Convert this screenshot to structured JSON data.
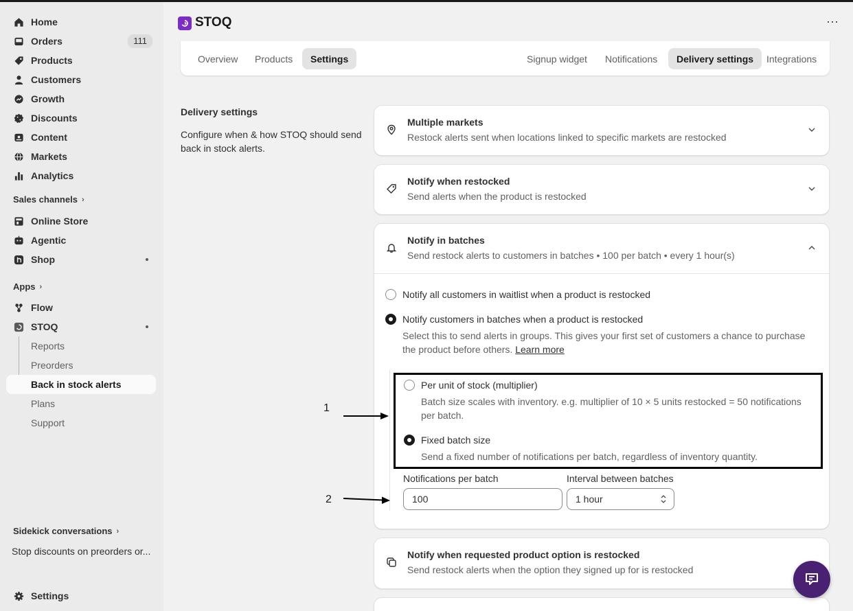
{
  "sidebar": {
    "items": [
      {
        "label": "Home",
        "icon": "home-icon"
      },
      {
        "label": "Orders",
        "icon": "inbox-icon",
        "badge": "111"
      },
      {
        "label": "Products",
        "icon": "tag-icon"
      },
      {
        "label": "Customers",
        "icon": "person-icon"
      },
      {
        "label": "Growth",
        "icon": "growth-icon"
      },
      {
        "label": "Discounts",
        "icon": "discount-icon"
      },
      {
        "label": "Content",
        "icon": "image-icon"
      },
      {
        "label": "Markets",
        "icon": "globe-icon"
      },
      {
        "label": "Analytics",
        "icon": "bar-chart-icon"
      }
    ],
    "sales_channels": {
      "heading": "Sales channels",
      "items": [
        {
          "label": "Online Store",
          "icon": "store-icon"
        },
        {
          "label": "Agentic",
          "icon": "agent-icon"
        },
        {
          "label": "Shop",
          "icon": "shop-icon"
        }
      ]
    },
    "apps": {
      "heading": "Apps",
      "items": [
        {
          "label": "Flow",
          "icon": "flow-icon"
        },
        {
          "label": "STOQ",
          "icon": "stoq-icon"
        }
      ],
      "sub_items": [
        "Reports",
        "Preorders",
        "Back in stock alerts",
        "Plans",
        "Support"
      ]
    },
    "sidekick": {
      "heading": "Sidekick conversations",
      "conversation": "Stop discounts on preorders or..."
    },
    "settings_label": "Settings"
  },
  "header": {
    "app_name": "STOQ",
    "more": "⋯"
  },
  "tabs_left": [
    "Overview",
    "Products",
    "Settings"
  ],
  "tabs_right": [
    "Signup widget",
    "Notifications",
    "Delivery settings",
    "Integrations"
  ],
  "section": {
    "title": "Delivery settings",
    "description": "Configure when & how STOQ should send back in stock alerts."
  },
  "cards": {
    "markets": {
      "title": "Multiple markets",
      "subtitle": "Restock alerts sent when locations linked to specific markets are restocked"
    },
    "restocked": {
      "title": "Notify when restocked",
      "subtitle": "Send alerts when the product is restocked"
    },
    "batches": {
      "title": "Notify in batches",
      "subtitle": "Send restock alerts to customers in batches • 100 per batch • every 1 hour(s)",
      "option_all": "Notify all customers in waitlist when a product is restocked",
      "option_batches": "Notify customers in batches when a product is restocked",
      "batches_help": "Select this to send alerts in groups. This gives your first set of customers a chance to purchase the product before others.",
      "learn_more": "Learn more",
      "per_unit_label": "Per unit of stock (multiplier)",
      "per_unit_help": "Batch size scales with inventory. e.g. multiplier of 10 × 5 units restocked = 50 notifications per batch.",
      "fixed_label": "Fixed batch size",
      "fixed_help": "Send a fixed number of notifications per batch, regardless of inventory quantity.",
      "per_batch_label": "Notifications per batch",
      "per_batch_value": "100",
      "interval_label": "Interval between batches",
      "interval_value": "1 hour"
    },
    "option": {
      "title": "Notify when requested product option is restocked",
      "subtitle": "Send restock alerts when the option they signed up for is restocked"
    }
  },
  "annotations": [
    "1",
    "2"
  ],
  "colors": {
    "brand": "#7b2cc4",
    "chat": "#4a2172"
  }
}
